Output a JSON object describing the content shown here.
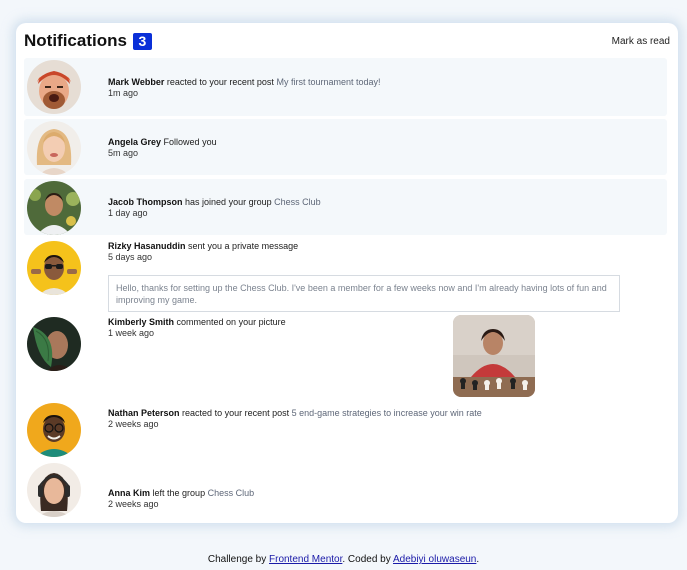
{
  "header": {
    "title": "Notifications",
    "unread_count": "3",
    "mark_all_label": "Mark as read"
  },
  "notifications": [
    {
      "name": "Mark Webber",
      "action": "reacted to your recent post",
      "object": "My first tournament today!",
      "time": "1m ago",
      "unread": true
    },
    {
      "name": "Angela Grey",
      "action": "Followed you",
      "object": "",
      "time": "5m ago",
      "unread": true
    },
    {
      "name": "Jacob Thompson",
      "action": "has joined your group",
      "object": "Chess Club",
      "time": "1 day ago",
      "unread": true
    },
    {
      "name": "Rizky Hasanuddin",
      "action": "sent you a private message",
      "object": "",
      "time": "5 days ago",
      "unread": false,
      "message": "Hello, thanks for setting up the Chess Club. I've been a member for a few weeks now and I'm already having lots of fun and improving my game."
    },
    {
      "name": "Kimberly Smith",
      "action": "commented on your picture",
      "object": "",
      "time": "1 week ago",
      "unread": false
    },
    {
      "name": "Nathan Peterson",
      "action": "reacted to your recent post",
      "object": "5 end-game strategies to increase your win rate",
      "time": "2 weeks ago",
      "unread": false
    },
    {
      "name": "Anna Kim",
      "action": "left the group",
      "object": "Chess Club",
      "time": "2 weeks ago",
      "unread": false
    }
  ],
  "footer": {
    "prefix": "Challenge by",
    "link1": "Frontend Mentor",
    "middle": ". Coded by",
    "link2": "Adebiyi oluwaseun",
    "suffix": "."
  },
  "colors": {
    "accent_badge": "#0a2fd8",
    "unread_bg": "#f4f8fb",
    "object_link": "#5e6778",
    "page_bg": "#f3f7fb"
  }
}
